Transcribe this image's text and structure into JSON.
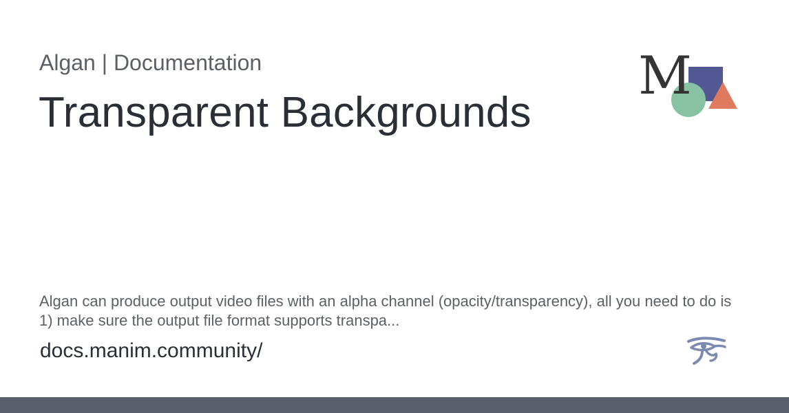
{
  "card": {
    "site_name": "Algan | Documentation",
    "title": "Transparent Backgrounds",
    "description": "Algan can produce output video files with an alpha channel (opacity/transparency), all you need to do is 1) make sure the output file format supports transpa...",
    "domain": "docs.manim.community/"
  },
  "logo": {
    "letter": "M",
    "icon": "manim-logo-icon",
    "colors": {
      "square": "#525893",
      "triangle": "#e07a5f",
      "circle": "#87c2a5",
      "letter": "#343434"
    }
  },
  "footer_icon": {
    "icon": "eye-of-horus-icon",
    "color": "#7d8ab0"
  },
  "colors": {
    "bottom_bar": "#5a5f6b"
  }
}
